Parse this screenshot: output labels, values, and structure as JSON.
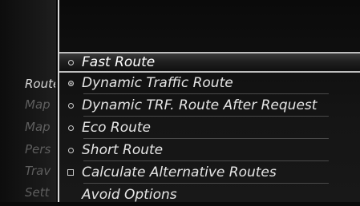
{
  "left_menu": {
    "items": [
      {
        "label": "Route",
        "active": true
      },
      {
        "label": "Map",
        "active": false
      },
      {
        "label": "Map",
        "active": false
      },
      {
        "label": "Pers",
        "active": false
      },
      {
        "label": "Trav",
        "active": false
      },
      {
        "label": "Sett",
        "active": false
      }
    ]
  },
  "route_menu": {
    "options": [
      {
        "label": "Fast Route",
        "marker": "radio",
        "selected": false,
        "highlighted": true
      },
      {
        "label": "Dynamic Traffic Route",
        "marker": "radio",
        "selected": true,
        "highlighted": false
      },
      {
        "label": "Dynamic TRF. Route After Request",
        "marker": "radio",
        "selected": false,
        "highlighted": false
      },
      {
        "label": "Eco Route",
        "marker": "radio",
        "selected": false,
        "highlighted": false
      },
      {
        "label": "Short Route",
        "marker": "radio",
        "selected": false,
        "highlighted": false
      },
      {
        "label": "Calculate Alternative Routes",
        "marker": "checkbox",
        "selected": false,
        "highlighted": false
      },
      {
        "label": "Avoid Options",
        "marker": "none",
        "selected": false,
        "highlighted": false
      }
    ]
  },
  "colors": {
    "text": "#e6e6e6",
    "text_dim": "#5e5e5e",
    "highlight_border": "#bdbdbd",
    "background": "#0a0a0a"
  }
}
